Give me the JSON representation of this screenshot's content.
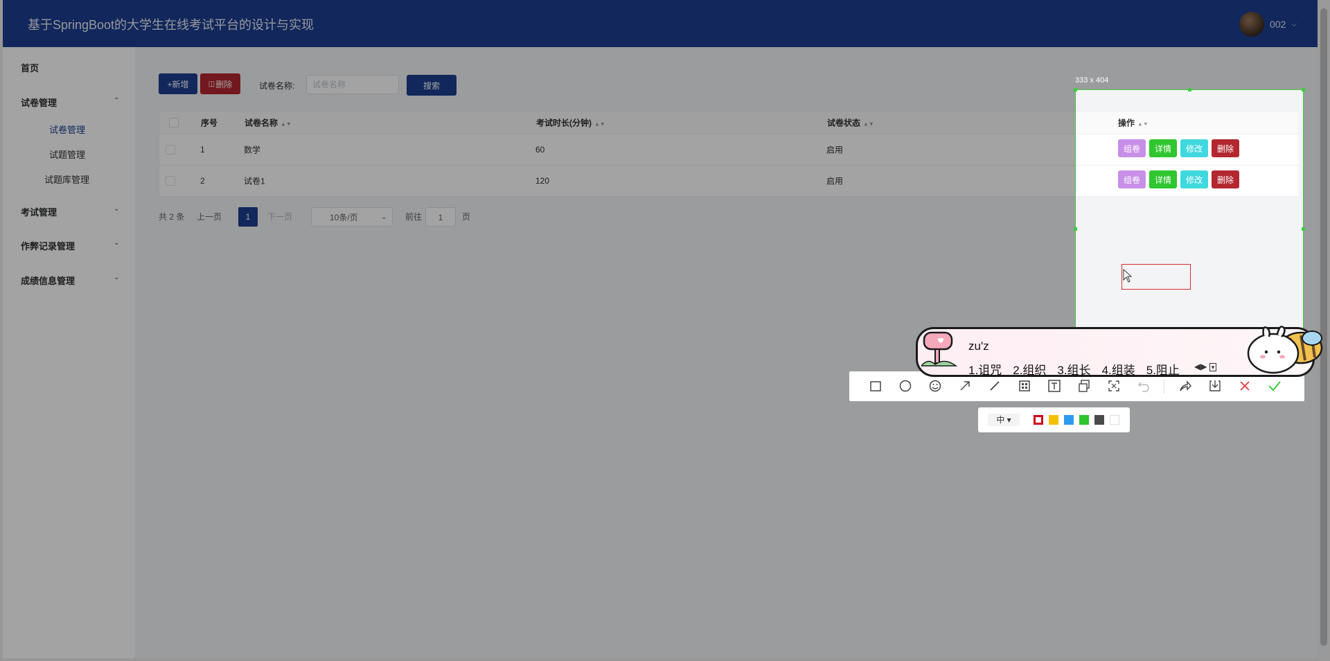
{
  "header": {
    "title": "基于SpringBoot的大学生在线考试平台的设计与实现",
    "user": "002"
  },
  "sidebar": {
    "home": "首页",
    "groups": [
      {
        "label": "试卷管理",
        "expanded": true,
        "children": [
          "试卷管理",
          "试题管理",
          "试题库管理"
        ]
      },
      {
        "label": "考试管理"
      },
      {
        "label": "作弊记录管理"
      },
      {
        "label": "成绩信息管理"
      }
    ]
  },
  "toolbar": {
    "add_label": "+新增",
    "delete_label": "删除",
    "name_label": "试卷名称:",
    "search_placeholder": "试卷名称",
    "search_label": "搜索"
  },
  "table": {
    "headers": {
      "index": "序号",
      "name": "试卷名称",
      "duration": "考试时长(分钟)",
      "status": "试卷状态",
      "ops": "操作"
    },
    "rows": [
      {
        "index": "1",
        "name": "数学",
        "duration": "60",
        "status": "启用"
      },
      {
        "index": "2",
        "name": "试卷1",
        "duration": "120",
        "status": "启用"
      }
    ],
    "op_labels": {
      "compose": "组卷",
      "detail": "详情",
      "edit": "修改",
      "delete": "删除"
    }
  },
  "pagination": {
    "total": "共 2 条",
    "prev": "上一页",
    "current": "1",
    "next": "下一页",
    "page_size": "10条/页",
    "goto": "前往",
    "goto_value": "1",
    "page_suffix": "页"
  },
  "screenshot_tool": {
    "selection_size": "333 x 404",
    "font_size": "中",
    "colors": [
      "#d0021b",
      "#f5c000",
      "#2d9cf0",
      "#2dc52d",
      "#4a4a4a",
      "#ffffff"
    ]
  },
  "ime": {
    "input": "zu'z",
    "candidates": [
      "1.诅咒",
      "2.组织",
      "3.组长",
      "4.组装",
      "5.阻止"
    ]
  },
  "colors": {
    "primary": "#1d3e8f",
    "danger": "#b3272f",
    "compose": "#c88fe8",
    "detail": "#2fc62f",
    "edit": "#40d8df",
    "delete": "#b3272f"
  }
}
